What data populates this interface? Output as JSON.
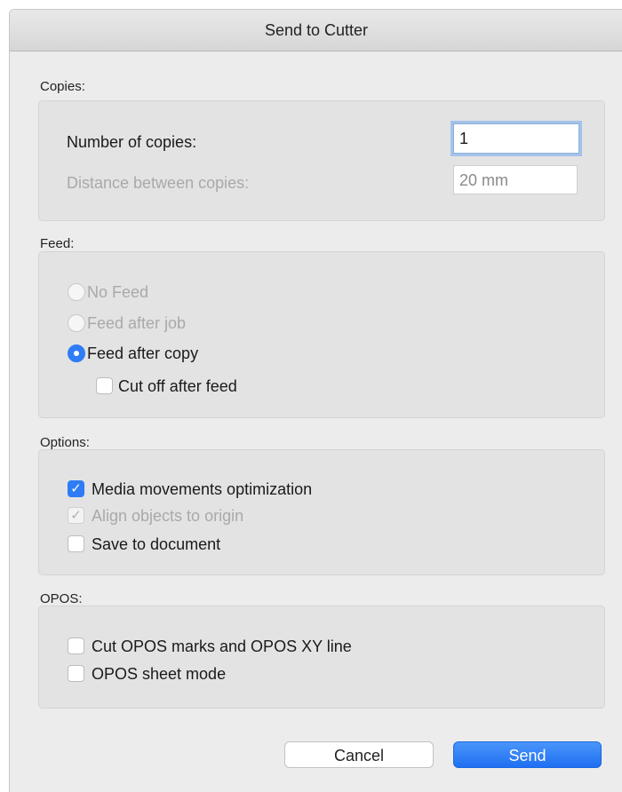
{
  "window": {
    "title": "Send to Cutter"
  },
  "copies": {
    "label": "Copies:",
    "number_label": "Number of copies:",
    "number_value": "1",
    "distance_label": "Distance between copies:",
    "distance_value": "20 mm"
  },
  "feed": {
    "label": "Feed:",
    "options": [
      {
        "label": "No Feed",
        "selected": false,
        "enabled": false
      },
      {
        "label": "Feed after job",
        "selected": false,
        "enabled": false
      },
      {
        "label": "Feed after copy",
        "selected": true,
        "enabled": true
      }
    ],
    "cut_off_label": "Cut off after feed",
    "cut_off_checked": false
  },
  "options": {
    "label": "Options:",
    "items": [
      {
        "label": "Media movements optimization",
        "checked": true,
        "enabled": true
      },
      {
        "label": "Align objects to origin",
        "checked": true,
        "enabled": false
      },
      {
        "label": "Save to document",
        "checked": false,
        "enabled": true
      }
    ]
  },
  "opos": {
    "label": "OPOS:",
    "items": [
      {
        "label": "Cut OPOS marks and OPOS XY line",
        "checked": false
      },
      {
        "label": "OPOS sheet mode",
        "checked": false
      }
    ]
  },
  "buttons": {
    "cancel": "Cancel",
    "send": "Send"
  },
  "colors": {
    "accent": "#2f7cf6",
    "panel": "#e3e3e3",
    "window": "#ececec"
  },
  "icons": {
    "checkmark": "checkmark-icon"
  }
}
